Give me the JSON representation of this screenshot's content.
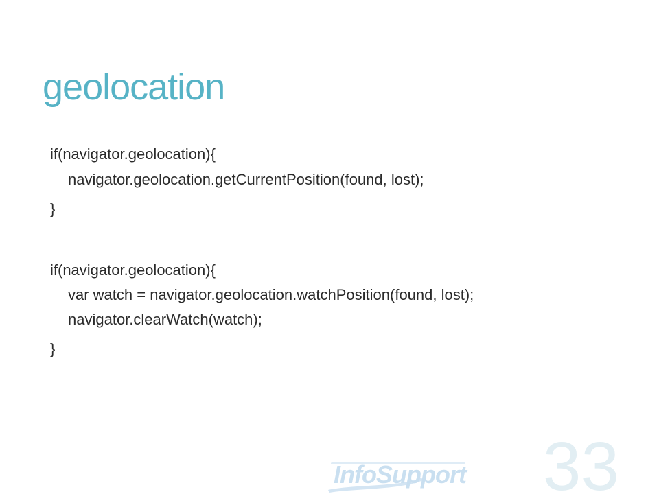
{
  "slide": {
    "title": "geolocation",
    "code_block_1": [
      "if(navigator.geolocation){",
      "navigator.geolocation.getCurrentPosition(found, lost);",
      "}"
    ],
    "code_block_2": [
      "if(navigator.geolocation){",
      "var watch = navigator.geolocation.watchPosition(found, lost);",
      "navigator.clearWatch(watch);",
      "}"
    ],
    "logo_text": "InfoSupport",
    "page_number": "33"
  },
  "colors": {
    "title": "#57b3c6",
    "code_text": "#2b2b2b",
    "logo": "#c9dff0",
    "page_number": "#e2eef3"
  }
}
